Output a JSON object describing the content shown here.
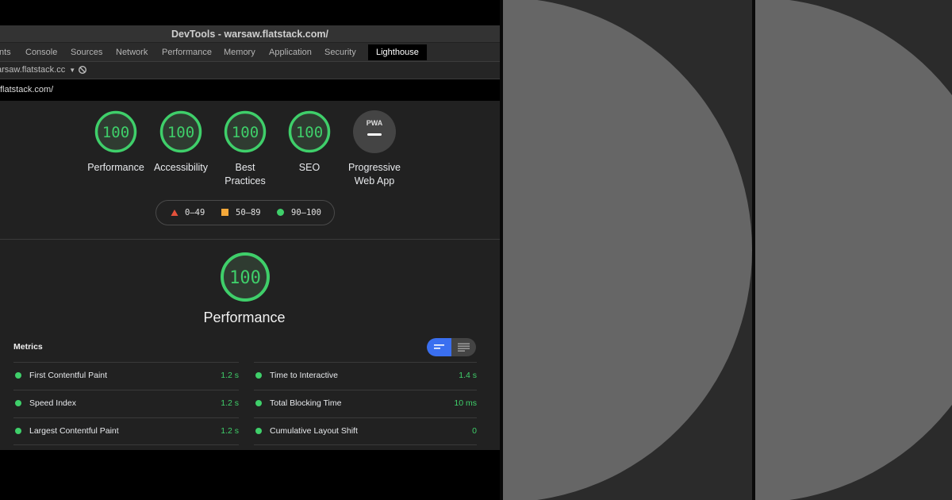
{
  "window": {
    "title": "DevTools - warsaw.flatstack.com/"
  },
  "tabs": [
    {
      "label": "nts"
    },
    {
      "label": "Console"
    },
    {
      "label": "Sources"
    },
    {
      "label": "Network"
    },
    {
      "label": "Performance"
    },
    {
      "label": "Memory"
    },
    {
      "label": "Application"
    },
    {
      "label": "Security"
    },
    {
      "label": "Lighthouse",
      "active": true
    }
  ],
  "toolbar": {
    "url_selector": "arsaw.flatstack.cc",
    "dropdown_glyph": "▼",
    "block_icon": "block-icon"
  },
  "url": "flatstack.com/",
  "categories": [
    {
      "score": "100",
      "label": "Performance"
    },
    {
      "score": "100",
      "label": "Accessibility"
    },
    {
      "score": "100",
      "label": "Best",
      "label2": "Practices"
    },
    {
      "score": "100",
      "label": "SEO"
    },
    {
      "badge": "PWA",
      "label": "Progressive",
      "label2": "Web App"
    }
  ],
  "legend": {
    "fail": "0–49",
    "average": "50–89",
    "pass": "90–100"
  },
  "performance": {
    "score": "100",
    "title": "Performance"
  },
  "metrics": {
    "title": "Metrics",
    "left": [
      {
        "name": "First Contentful Paint",
        "value": "1.2 s"
      },
      {
        "name": "Speed Index",
        "value": "1.2 s"
      },
      {
        "name": "Largest Contentful Paint",
        "value": "1.2 s"
      }
    ],
    "right": [
      {
        "name": "Time to Interactive",
        "value": "1.4 s"
      },
      {
        "name": "Total Blocking Time",
        "value": "10 ms"
      },
      {
        "name": "Cumulative Layout Shift",
        "value": "0"
      }
    ]
  },
  "colors": {
    "pass": "#3fcf6a",
    "average": "#f4a83a",
    "fail": "#e4513b",
    "toggle_active": "#3a6ff0",
    "deco_circle": "#666666"
  }
}
